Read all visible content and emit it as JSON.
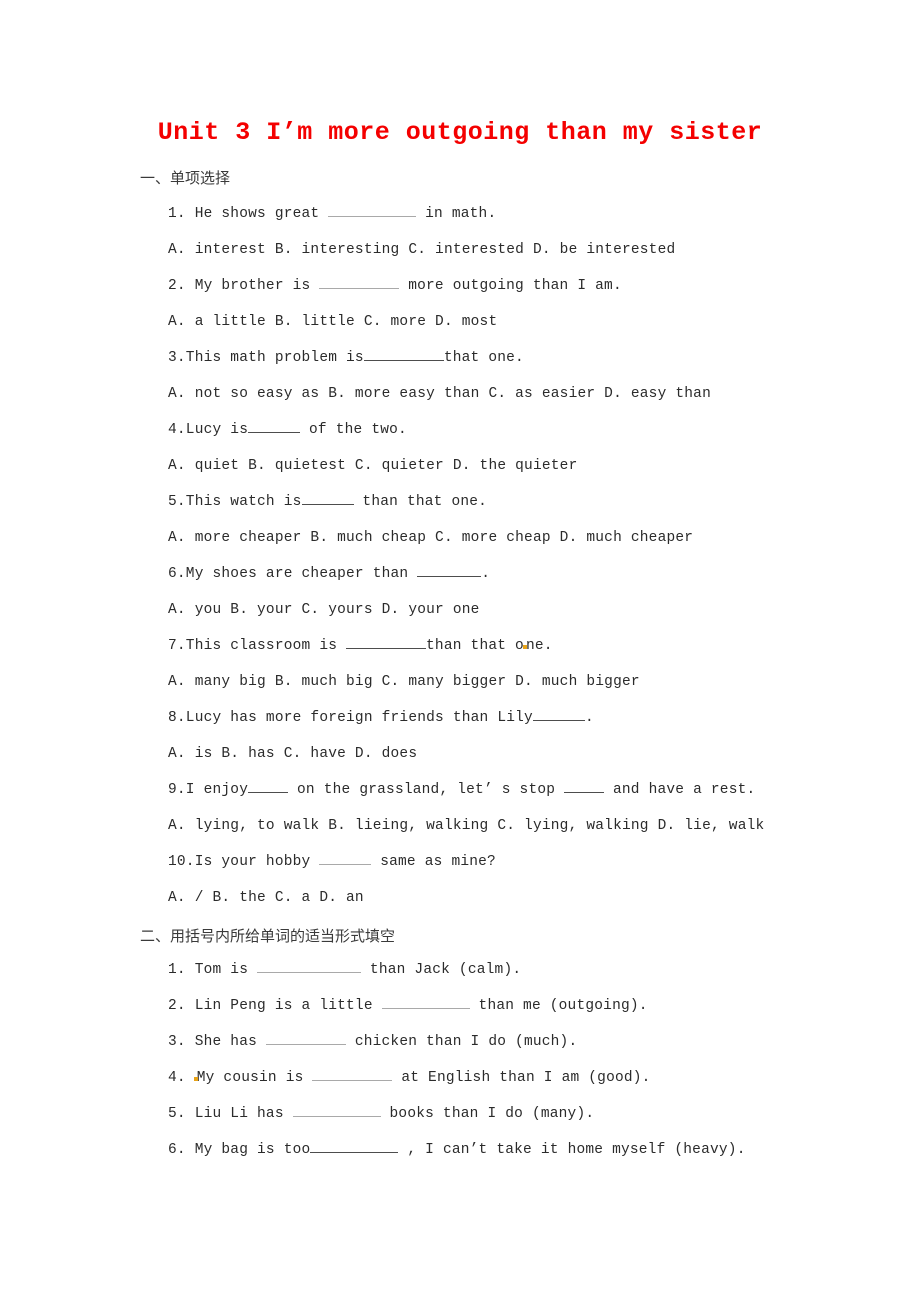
{
  "document": {
    "title": "Unit 3 I’m more outgoing than my sister",
    "title_color": "#f40000",
    "background_color": "#ffffff",
    "body_color": "#2b2b2b"
  },
  "sections": [
    {
      "heading": "一、单项选择",
      "lines": [
        {
          "id": "q1",
          "before": "1. He shows great ",
          "blank": "w88",
          "blank_style": "light",
          "after": " in math."
        },
        {
          "id": "q1-options",
          "text": "A. interest     B. interesting     C. interested    D. be interested"
        },
        {
          "id": "q2",
          "before": "2. My brother is ",
          "blank": "w80",
          "blank_style": "light",
          "after": " more outgoing than I am."
        },
        {
          "id": "q2-options",
          "text": "A. a little   B. little          C. more          D. most"
        },
        {
          "id": "q3",
          "before": "3.This math problem is",
          "blank": "w80",
          "blank_style": "dark",
          "after": "that one."
        },
        {
          "id": "q3-options",
          "text": "A. not so easy as   B. more easy than    C. as easier D. easy than"
        },
        {
          "id": "q4",
          "before": "4.Lucy is",
          "blank": "w52",
          "blank_style": "dark",
          "after": " of the two."
        },
        {
          "id": "q4-options",
          "text": "A. quiet   B. quietest   C. quieter  D. the quieter"
        },
        {
          "id": "q5",
          "before": "5.This watch is",
          "blank": "w52",
          "blank_style": "dark",
          "after": " than that one."
        },
        {
          "id": "q5-options",
          "text": "A. more cheaper    B. much cheap   C. more cheap    D. much cheaper"
        },
        {
          "id": "q6",
          "before": "6.My shoes are cheaper than ",
          "blank": "w64",
          "blank_style": "dark",
          "after": "."
        },
        {
          "id": "q6-options",
          "text": "A. you    B. your     C. yours    D. your one"
        },
        {
          "id": "q7",
          "before": "7.This classroom is ",
          "blank": "w80",
          "blank_style": "dark",
          "after": "than that o",
          "after2": "ne.",
          "speck": true
        },
        {
          "id": "q7-options",
          "text": "A. many big    B. much big     C. many bigger      D. much bigger"
        },
        {
          "id": "q8",
          "before": "8.Lucy has more foreign friends than Lily",
          "blank": "w52",
          "blank_style": "dark",
          "after": "."
        },
        {
          "id": "q8-options",
          "text": "A. is   B. has    C. have    D. does"
        },
        {
          "id": "q9",
          "before": "9.I enjoy",
          "blank": "w40",
          "blank_style": "dark",
          "after": " on the grassland, let’ s stop ",
          "blank2": "w40",
          "after2": " and have a rest."
        },
        {
          "id": "q9-options",
          "text": "A. lying, to walk   B. lieing, walking   C. lying, walking   D. lie, walk"
        },
        {
          "id": "q10",
          "before": "10.Is your hobby ",
          "blank": "w52",
          "blank_style": "light",
          "after": " same as mine?"
        },
        {
          "id": "q10-options",
          "text": "A. /     B. the      C. a      D. an"
        }
      ]
    },
    {
      "heading": "二、用括号内所给单词的适当形式填空",
      "lines": [
        {
          "id": "f1",
          "before": "1. Tom is ",
          "blank": "w104",
          "blank_style": "light",
          "after": " than Jack (calm)."
        },
        {
          "id": "f2",
          "before": "2. Lin Peng is a little ",
          "blank": "w88",
          "blank_style": "light",
          "after": " than me (outgoing)."
        },
        {
          "id": "f3",
          "before": "3. She has ",
          "blank": "w80",
          "blank_style": "light",
          "after": " chicken than I do (much)."
        },
        {
          "id": "f4",
          "before": "4. ",
          "speck_lead": true,
          "before2": "My cousin is ",
          "blank": "w80",
          "blank_style": "light",
          "after": " at English than I am (good)."
        },
        {
          "id": "f5",
          "before": "5. Liu Li has ",
          "blank": "w88",
          "blank_style": "light",
          "after": " books than I do (many)."
        },
        {
          "id": "f6",
          "before": "6. My bag is too",
          "blank": "w88",
          "blank_style": "dark",
          "after": " , I can’t take it home myself (heavy)."
        }
      ]
    }
  ]
}
